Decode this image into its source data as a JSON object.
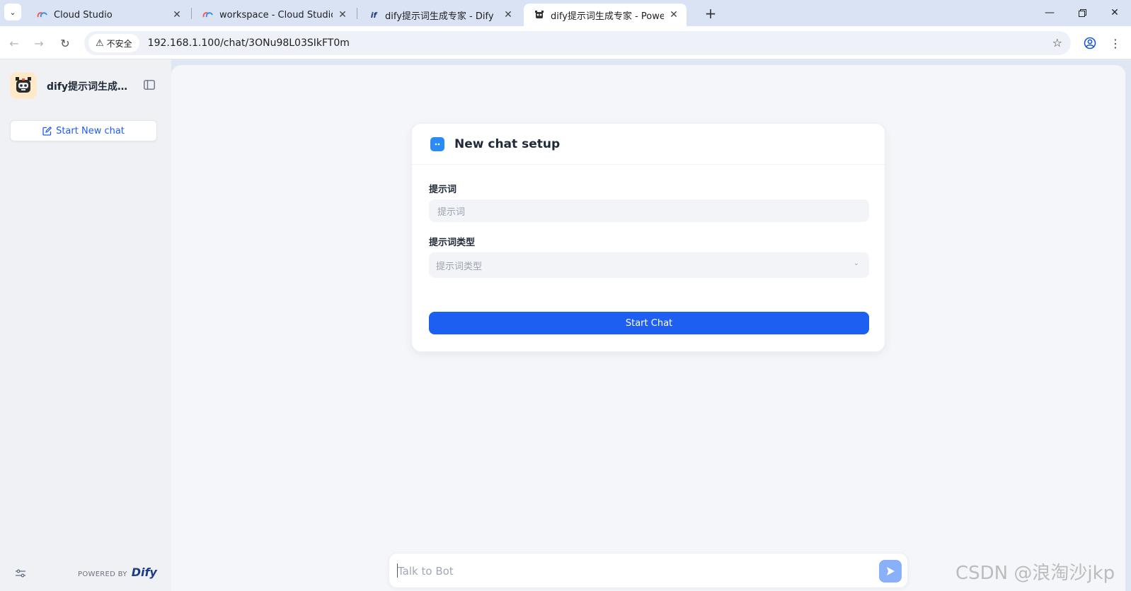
{
  "browser": {
    "tabs": [
      {
        "title": "Cloud Studio",
        "active": false
      },
      {
        "title": "workspace - Cloud Studio",
        "active": false
      },
      {
        "title": "dify提示词生成专家 - Dify",
        "active": false
      },
      {
        "title": "dify提示词生成专家 - Powered by Dify",
        "active": true
      }
    ],
    "new_tab_symbol": "+",
    "security_label": "不安全",
    "url": "192.168.1.100/chat/3ONu98L03SIkFT0m"
  },
  "sidebar": {
    "app_name": "dify提示词生成专家",
    "new_chat_label": "Start New chat",
    "powered_by": "POWERED BY",
    "brand": "Dify"
  },
  "setup": {
    "title": "New chat setup",
    "fields": [
      {
        "label": "提示词",
        "placeholder": "提示词"
      },
      {
        "label": "提示词类型",
        "placeholder": "提示词类型"
      }
    ],
    "start_label": "Start Chat"
  },
  "chat": {
    "placeholder": "Talk to Bot"
  },
  "watermark": "CSDN @浪淘沙jkp",
  "colors": {
    "primary": "#1d5ff0",
    "send_disabled": "#8ab0f9",
    "sidebar_bg": "#f0f1f4"
  }
}
